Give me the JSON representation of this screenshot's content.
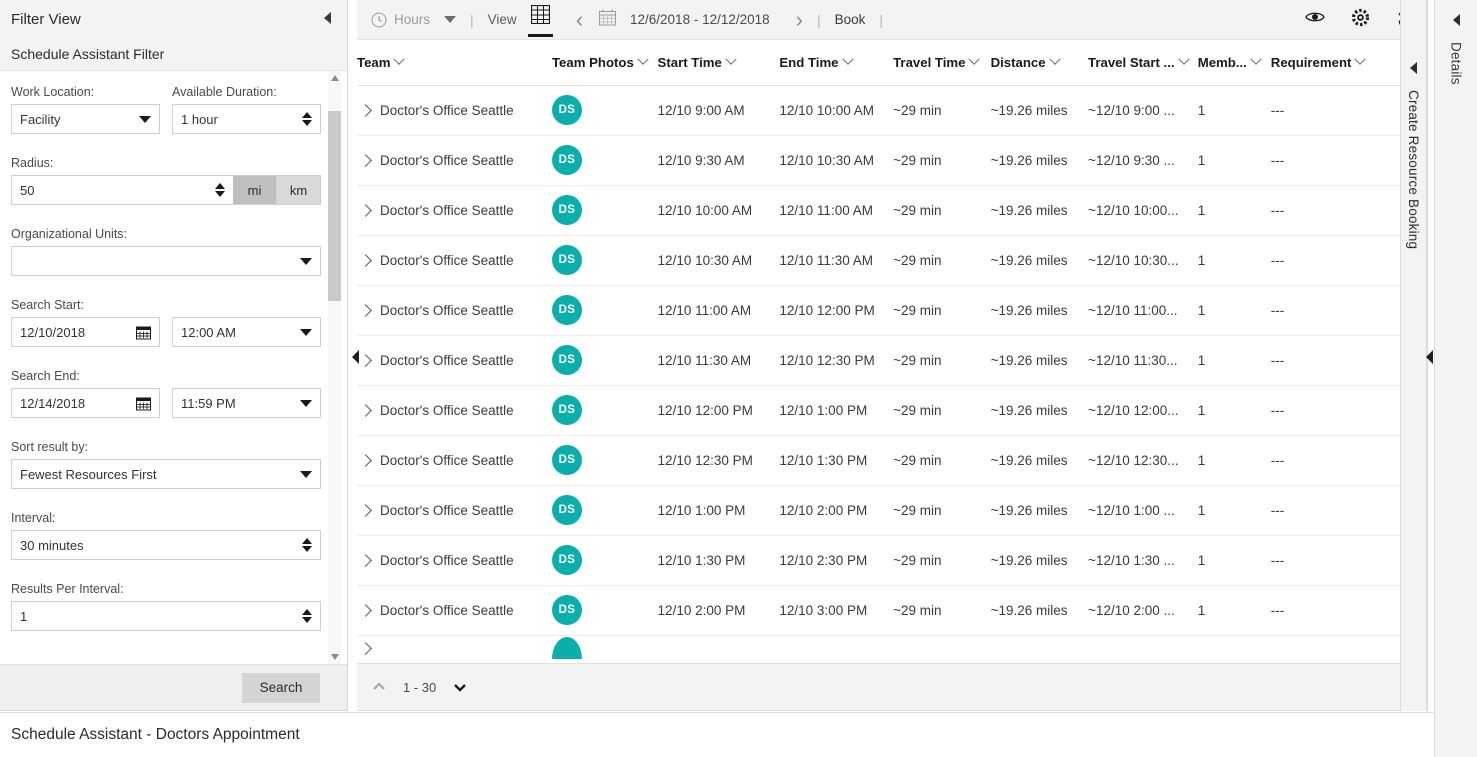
{
  "filter_panel": {
    "title": "Filter View",
    "subtitle": "Schedule Assistant Filter",
    "fields": {
      "work_location_label": "Work Location:",
      "work_location_value": "Facility",
      "available_duration_label": "Available Duration:",
      "available_duration_value": "1 hour",
      "radius_label": "Radius:",
      "radius_value": "50",
      "unit_mi": "mi",
      "unit_km": "km",
      "org_units_label": "Organizational Units:",
      "org_units_value": "",
      "search_start_label": "Search Start:",
      "search_start_date": "12/10/2018",
      "search_start_time": "12:00 AM",
      "search_end_label": "Search End:",
      "search_end_date": "12/14/2018",
      "search_end_time": "11:59 PM",
      "sort_label": "Sort result by:",
      "sort_value": "Fewest Resources First",
      "interval_label": "Interval:",
      "interval_value": "30 minutes",
      "results_per_interval_label": "Results Per Interval:",
      "results_per_interval_value": "1"
    },
    "search_button": "Search"
  },
  "toolbar": {
    "hours_label": "Hours",
    "separator": "|",
    "view_label": "View",
    "date_range": "12/6/2018 - 12/12/2018",
    "book_label": "Book"
  },
  "table": {
    "columns": [
      "Team",
      "Team Photos",
      "Start Time",
      "End Time",
      "Travel Time",
      "Distance",
      "Travel Start ...",
      "Memb...",
      "Requirement"
    ],
    "rows": [
      {
        "team": "Doctor's Office Seattle",
        "photo": "DS",
        "start": "12/10 9:00 AM",
        "end": "12/10 10:00 AM",
        "travel_time": "~29 min",
        "distance": "~19.26 miles",
        "travel_start": "~12/10 9:00 ...",
        "members": "1",
        "requirement": "---"
      },
      {
        "team": "Doctor's Office Seattle",
        "photo": "DS",
        "start": "12/10 9:30 AM",
        "end": "12/10 10:30 AM",
        "travel_time": "~29 min",
        "distance": "~19.26 miles",
        "travel_start": "~12/10 9:30 ...",
        "members": "1",
        "requirement": "---"
      },
      {
        "team": "Doctor's Office Seattle",
        "photo": "DS",
        "start": "12/10 10:00 AM",
        "end": "12/10 11:00 AM",
        "travel_time": "~29 min",
        "distance": "~19.26 miles",
        "travel_start": "~12/10 10:00...",
        "members": "1",
        "requirement": "---"
      },
      {
        "team": "Doctor's Office Seattle",
        "photo": "DS",
        "start": "12/10 10:30 AM",
        "end": "12/10 11:30 AM",
        "travel_time": "~29 min",
        "distance": "~19.26 miles",
        "travel_start": "~12/10 10:30...",
        "members": "1",
        "requirement": "---"
      },
      {
        "team": "Doctor's Office Seattle",
        "photo": "DS",
        "start": "12/10 11:00 AM",
        "end": "12/10 12:00 PM",
        "travel_time": "~29 min",
        "distance": "~19.26 miles",
        "travel_start": "~12/10 11:00...",
        "members": "1",
        "requirement": "---"
      },
      {
        "team": "Doctor's Office Seattle",
        "photo": "DS",
        "start": "12/10 11:30 AM",
        "end": "12/10 12:30 PM",
        "travel_time": "~29 min",
        "distance": "~19.26 miles",
        "travel_start": "~12/10 11:30...",
        "members": "1",
        "requirement": "---"
      },
      {
        "team": "Doctor's Office Seattle",
        "photo": "DS",
        "start": "12/10 12:00 PM",
        "end": "12/10 1:00 PM",
        "travel_time": "~29 min",
        "distance": "~19.26 miles",
        "travel_start": "~12/10 12:00...",
        "members": "1",
        "requirement": "---"
      },
      {
        "team": "Doctor's Office Seattle",
        "photo": "DS",
        "start": "12/10 12:30 PM",
        "end": "12/10 1:30 PM",
        "travel_time": "~29 min",
        "distance": "~19.26 miles",
        "travel_start": "~12/10 12:30...",
        "members": "1",
        "requirement": "---"
      },
      {
        "team": "Doctor's Office Seattle",
        "photo": "DS",
        "start": "12/10 1:00 PM",
        "end": "12/10 2:00 PM",
        "travel_time": "~29 min",
        "distance": "~19.26 miles",
        "travel_start": "~12/10 1:00 ...",
        "members": "1",
        "requirement": "---"
      },
      {
        "team": "Doctor's Office Seattle",
        "photo": "DS",
        "start": "12/10 1:30 PM",
        "end": "12/10 2:30 PM",
        "travel_time": "~29 min",
        "distance": "~19.26 miles",
        "travel_start": "~12/10 1:30 ...",
        "members": "1",
        "requirement": "---"
      },
      {
        "team": "Doctor's Office Seattle",
        "photo": "DS",
        "start": "12/10 2:00 PM",
        "end": "12/10 3:00 PM",
        "travel_time": "~29 min",
        "distance": "~19.26 miles",
        "travel_start": "~12/10 2:00 ...",
        "members": "1",
        "requirement": "---"
      }
    ]
  },
  "pager": {
    "range": "1 - 30"
  },
  "rails": {
    "create_booking": "Create Resource Booking",
    "details": "Details"
  },
  "footer": {
    "title": "Schedule Assistant - Doctors Appointment"
  },
  "colors": {
    "avatar_teal": "#0aafac",
    "toolbar_bg": "#f3f3f3",
    "unit_active": "#bfbfbf"
  }
}
